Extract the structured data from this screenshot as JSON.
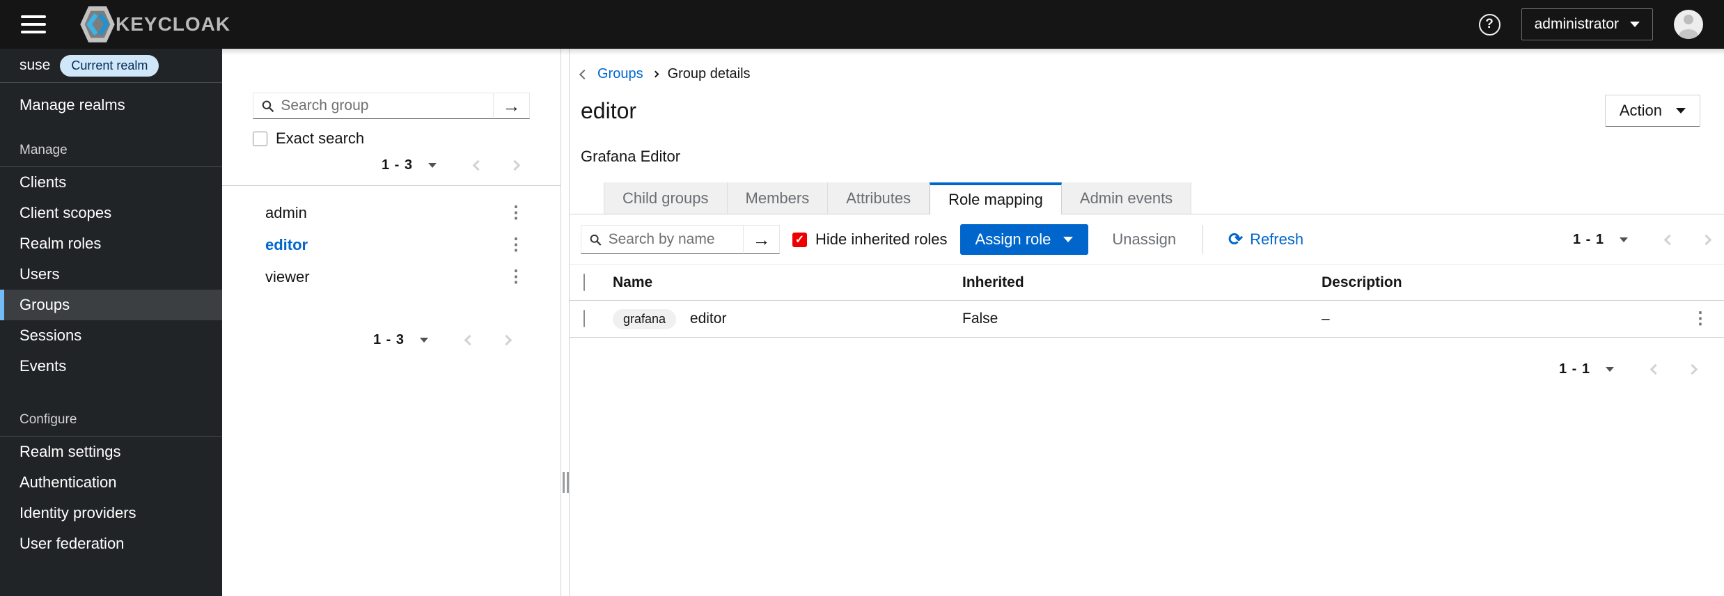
{
  "colors": {
    "accent_blue": "#0066cc",
    "masthead_bg": "#151515",
    "nav_bg": "#212427",
    "nav_active_bg": "#3c3f42",
    "nav_active_accent": "#73bcf7",
    "checkbox_checked_red": "#ee0000",
    "realm_badge_bg": "#cfe7f8",
    "realm_badge_text": "#002952"
  },
  "glyphs": {
    "kebab": "⋮",
    "refresh": "⟳",
    "arrow_submit": "→",
    "check": "✓",
    "question": "?"
  },
  "masthead": {
    "logo_text": "KEYCLOAK",
    "user_menu": "administrator"
  },
  "sidebar": {
    "realm": {
      "name": "suse",
      "badge": "Current realm"
    },
    "manage_realms_label": "Manage realms",
    "sections": [
      {
        "label": "Manage",
        "items": [
          {
            "label": "Clients"
          },
          {
            "label": "Client scopes"
          },
          {
            "label": "Realm roles"
          },
          {
            "label": "Users"
          },
          {
            "label": "Groups",
            "active": true
          },
          {
            "label": "Sessions"
          },
          {
            "label": "Events"
          }
        ]
      },
      {
        "label": "Configure",
        "items": [
          {
            "label": "Realm settings"
          },
          {
            "label": "Authentication"
          },
          {
            "label": "Identity providers"
          },
          {
            "label": "User federation"
          }
        ]
      }
    ]
  },
  "groups_panel": {
    "search_placeholder": "Search group",
    "exact_search_label": "Exact search",
    "pagination_top": {
      "range": "1 - 3"
    },
    "groups": [
      {
        "name": "admin"
      },
      {
        "name": "editor",
        "selected": true
      },
      {
        "name": "viewer"
      }
    ],
    "pagination_bottom": {
      "range": "1 - 3"
    }
  },
  "main": {
    "breadcrumb": {
      "link": "Groups",
      "current": "Group details"
    },
    "title": "editor",
    "subtitle": "Grafana Editor",
    "action_button": "Action",
    "tabs": [
      {
        "label": "Child groups"
      },
      {
        "label": "Members"
      },
      {
        "label": "Attributes"
      },
      {
        "label": "Role mapping",
        "active": true
      },
      {
        "label": "Admin events"
      }
    ],
    "toolbar": {
      "search_placeholder": "Search by name",
      "hide_inherited_label": "Hide inherited roles",
      "hide_inherited_checked": true,
      "assign_button": "Assign role",
      "unassign_button": "Unassign",
      "refresh_label": "Refresh",
      "pagination": {
        "range": "1 - 1"
      }
    },
    "table": {
      "columns": [
        "Name",
        "Inherited",
        "Description"
      ],
      "rows": [
        {
          "client_badge": "grafana",
          "name": "editor",
          "inherited": "False",
          "description": "–"
        }
      ]
    },
    "pagination_bottom": {
      "range": "1 - 1"
    }
  }
}
